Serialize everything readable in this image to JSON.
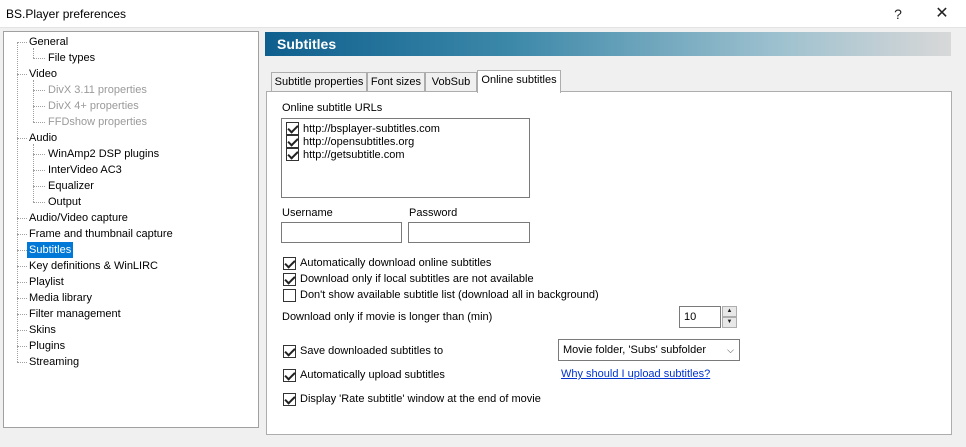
{
  "window": {
    "title": "BS.Player preferences",
    "help_glyph": "?",
    "close_glyph": "✕"
  },
  "tree": {
    "items": [
      {
        "label": "General",
        "level": 0
      },
      {
        "label": "File types",
        "level": 1
      },
      {
        "label": "Video",
        "level": 0
      },
      {
        "label": "DivX 3.11 properties",
        "level": 1,
        "disabled": true
      },
      {
        "label": "DivX 4+ properties",
        "level": 1,
        "disabled": true
      },
      {
        "label": "FFDshow properties",
        "level": 1,
        "disabled": true
      },
      {
        "label": "Audio",
        "level": 0
      },
      {
        "label": "WinAmp2 DSP plugins",
        "level": 1
      },
      {
        "label": "InterVideo AC3",
        "level": 1
      },
      {
        "label": "Equalizer",
        "level": 1
      },
      {
        "label": "Output",
        "level": 1
      },
      {
        "label": "Audio/Video capture",
        "level": 0
      },
      {
        "label": "Frame and thumbnail capture",
        "level": 0
      },
      {
        "label": "Subtitles",
        "level": 0,
        "selected": true
      },
      {
        "label": "Key definitions & WinLIRC",
        "level": 0
      },
      {
        "label": "Playlist",
        "level": 0
      },
      {
        "label": "Media library",
        "level": 0
      },
      {
        "label": "Filter management",
        "level": 0
      },
      {
        "label": "Skins",
        "level": 0
      },
      {
        "label": "Plugins",
        "level": 0
      },
      {
        "label": "Streaming",
        "level": 0
      }
    ]
  },
  "header": {
    "title": "Subtitles"
  },
  "tabs": [
    {
      "label": "Subtitle properties"
    },
    {
      "label": "Font sizes"
    },
    {
      "label": "VobSub"
    },
    {
      "label": "Online subtitles",
      "active": true
    }
  ],
  "online": {
    "urls_label": "Online subtitle URLs",
    "urls": [
      {
        "url": "http://bsplayer-subtitles.com",
        "checked": true
      },
      {
        "url": "http://opensubtitles.org",
        "checked": true
      },
      {
        "url": "http://getsubtitle.com",
        "checked": true
      }
    ],
    "username_label": "Username",
    "password_label": "Password",
    "username_value": "",
    "password_value": "",
    "auto_download_label": "Automatically download online subtitles",
    "download_only_label": "Download only if local subtitles are not available",
    "dont_show_label": "Don't show available subtitle list (download all in background)",
    "min_length_label": "Download only if movie is longer than (min)",
    "min_length_value": "10",
    "save_label": "Save downloaded subtitles to",
    "save_location": "Movie folder, 'Subs' subfolder",
    "auto_upload_label": "Automatically upload subtitles",
    "why_upload_link": "Why should I upload subtitles?",
    "rate_label": "Display 'Rate subtitle' window at the end of movie",
    "checks": {
      "auto_download": true,
      "download_only": true,
      "dont_show": false,
      "save": true,
      "auto_upload": true,
      "rate": true
    }
  }
}
